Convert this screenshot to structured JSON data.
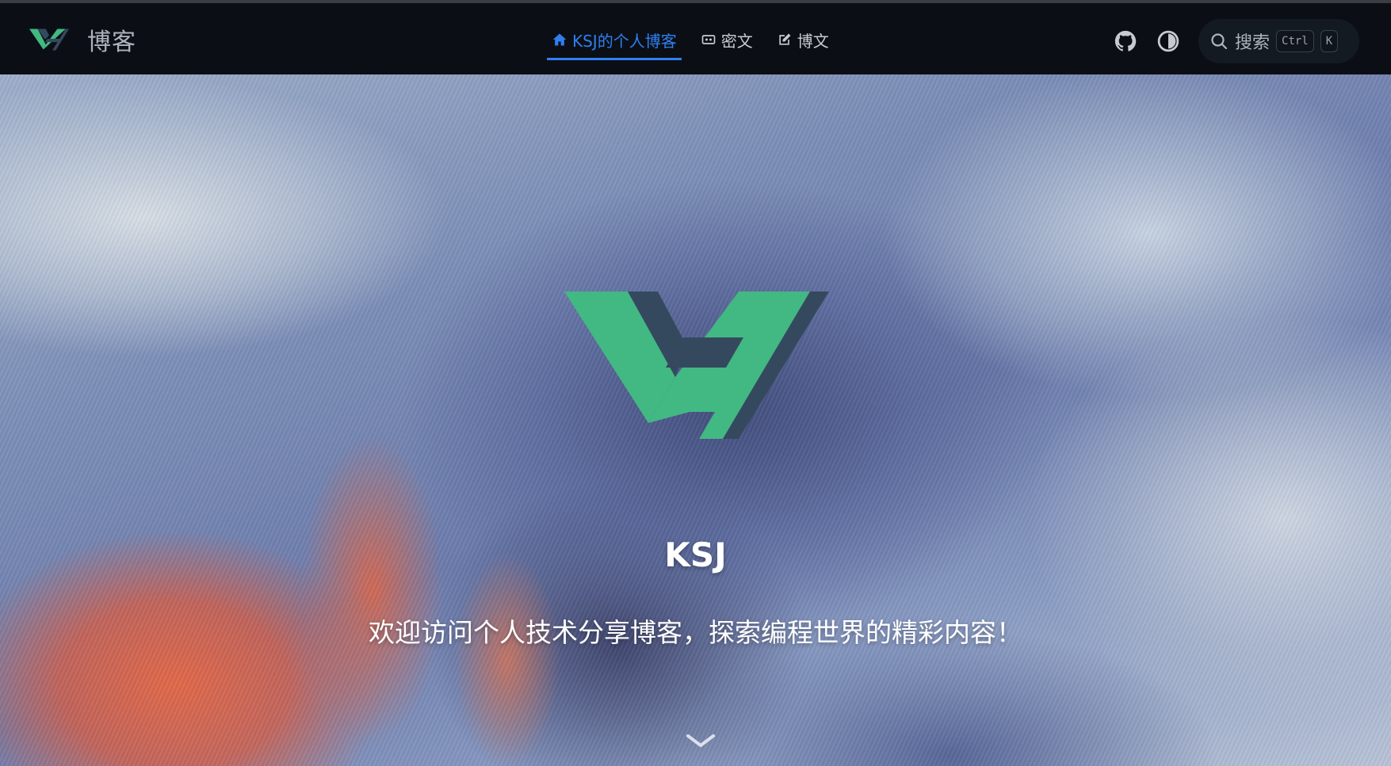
{
  "navbar": {
    "brand_title": "博客",
    "logo_icon": "vh-logo-icon",
    "links": [
      {
        "label": "KSJ的个人博客",
        "icon": "home-icon",
        "active": true
      },
      {
        "label": "密文",
        "icon": "mask-icon",
        "active": false
      },
      {
        "label": "博文",
        "icon": "edit-icon",
        "active": false
      }
    ],
    "github_icon": "github-icon",
    "theme_icon": "contrast-icon",
    "search": {
      "label": "搜索",
      "icon": "search-icon",
      "keys": [
        "Ctrl",
        "K"
      ]
    }
  },
  "hero": {
    "name": "KSJ",
    "tagline": "欢迎访问个人技术分享博客，探索编程世界的精彩内容！",
    "scroll_icon": "chevron-down-icon"
  },
  "colors": {
    "accent": "#2f7ff0",
    "logo_green": "#42b883",
    "logo_dark": "#35495e",
    "navbar_bg": "#0b0f15"
  }
}
